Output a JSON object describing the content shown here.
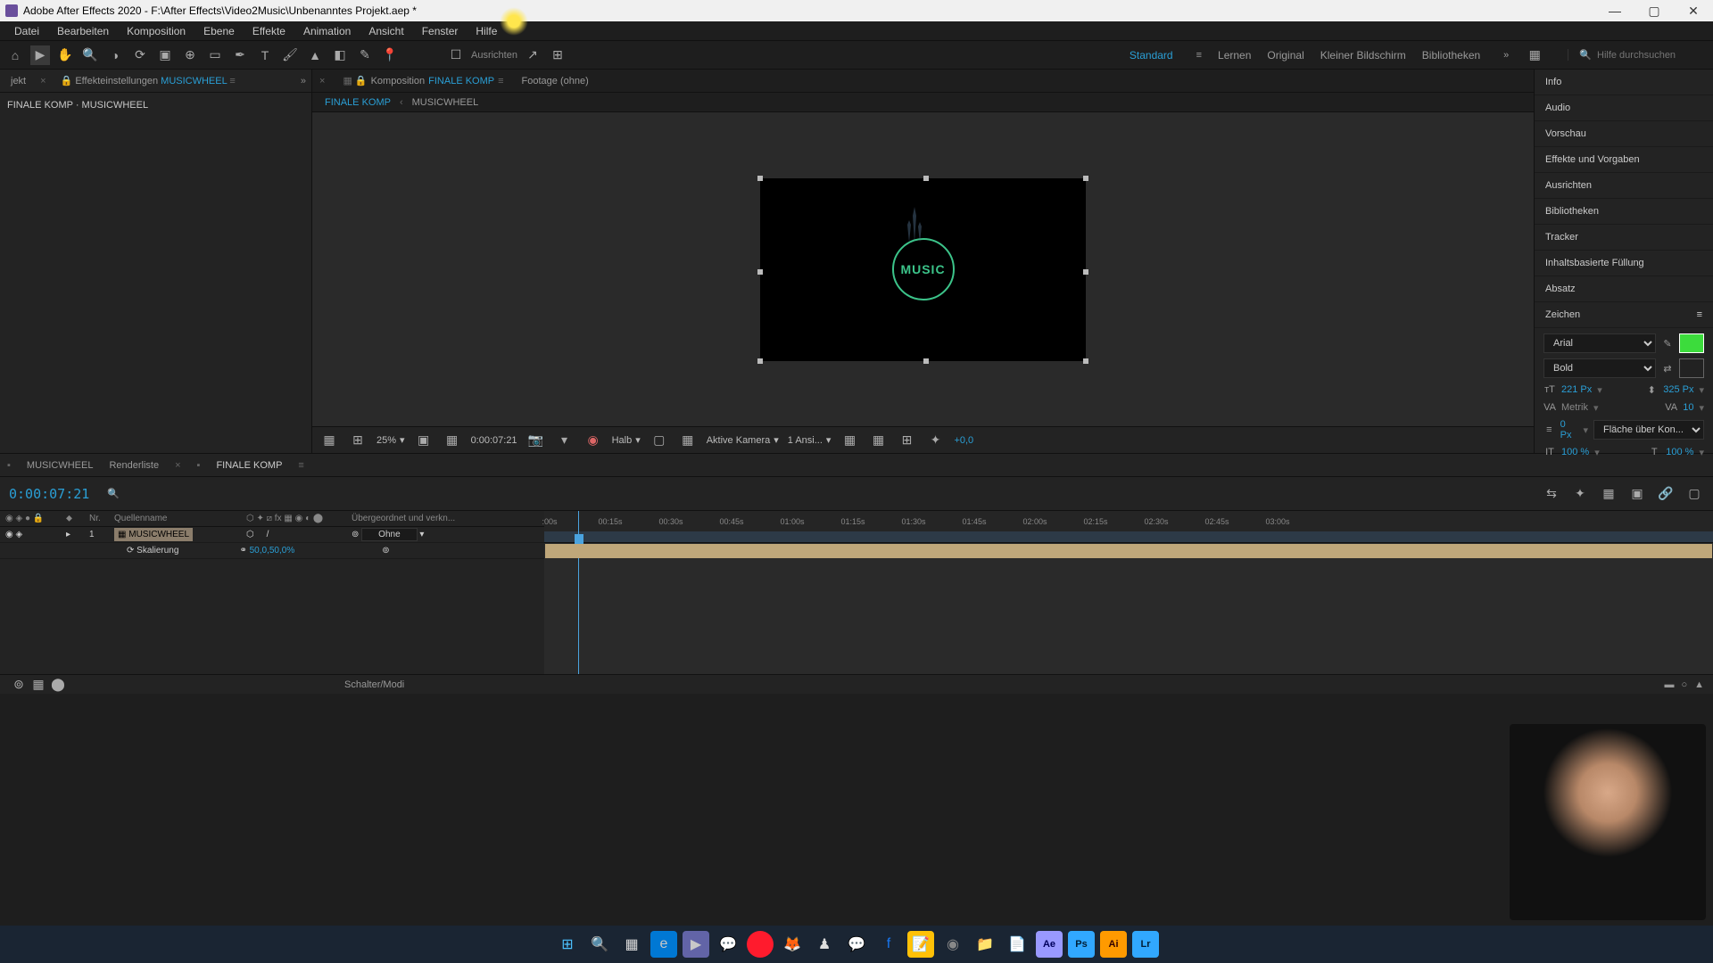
{
  "titlebar": {
    "app_name": "Adobe After Effects 2020",
    "project_path": "F:\\After Effects\\Video2Music\\Unbenanntes Projekt.aep *"
  },
  "menubar": [
    "Datei",
    "Bearbeiten",
    "Komposition",
    "Ebene",
    "Effekte",
    "Animation",
    "Ansicht",
    "Fenster",
    "Hilfe"
  ],
  "toolbar": {
    "snap_label": "Ausrichten",
    "workspaces": [
      "Standard",
      "Lernen",
      "Original",
      "Kleiner Bildschirm",
      "Bibliotheken"
    ],
    "active_workspace": "Standard",
    "search_placeholder": "Hilfe durchsuchen"
  },
  "left_panel": {
    "tab_project_short": "jekt",
    "tab_effect_controls": "Effekteinstellungen",
    "active_comp": "MUSICWHEEL",
    "breadcrumb": "FINALE KOMP · MUSICWHEEL"
  },
  "center_panel": {
    "tab_comp_prefix": "Komposition",
    "tab_comp_name": "FINALE KOMP",
    "tab_footage": "Footage (ohne)",
    "breadcrumb_1": "FINALE KOMP",
    "breadcrumb_2": "MUSICWHEEL",
    "preview_text": "MUSIC",
    "controls": {
      "zoom": "25%",
      "timecode": "0:00:07:21",
      "res": "Halb",
      "camera": "Aktive Kamera",
      "views": "1 Ansi...",
      "exposure": "+0,0"
    }
  },
  "right_panel": {
    "items": [
      "Info",
      "Audio",
      "Vorschau",
      "Effekte und Vorgaben",
      "Ausrichten",
      "Bibliotheken",
      "Tracker",
      "Inhaltsbasierte Füllung",
      "Absatz"
    ],
    "char_header": "Zeichen",
    "char": {
      "font": "Arial",
      "style": "Bold",
      "size": "221 Px",
      "leading": "325 Px",
      "kerning": "Metrik",
      "tracking": "10",
      "stroke_w": "0 Px",
      "stroke_mode": "Fläche über Kon...",
      "vscale": "100 %",
      "hscale": "100 %",
      "color": "#3cdc3c"
    }
  },
  "timeline": {
    "tabs": [
      "MUSICWHEEL",
      "Renderliste",
      "FINALE KOMP"
    ],
    "active_tab": "FINALE KOMP",
    "timecode": "0:00:07:21",
    "cols": {
      "nr": "Nr.",
      "source": "Quellenname",
      "parent": "Übergeordnet und verkn..."
    },
    "layer": {
      "num": "1",
      "name": "MUSICWHEEL",
      "prop_scale": "Skalierung",
      "scale_val": "50,0,50,0%",
      "parent": "Ohne"
    },
    "ruler_ticks": [
      ":00s",
      "00:15s",
      "00:30s",
      "00:45s",
      "01:00s",
      "01:15s",
      "01:30s",
      "01:45s",
      "02:00s",
      "02:15s",
      "02:30s",
      "02:45s",
      "03:00s"
    ],
    "footer": "Schalter/Modi"
  },
  "taskbar_icons": [
    "windows",
    "search",
    "taskview",
    "edge",
    "video",
    "whatsapp",
    "opera",
    "firefox",
    "steam",
    "messenger",
    "facebook",
    "notes",
    "obs",
    "explorer",
    "editor",
    "ae",
    "ps",
    "ai",
    "lr"
  ]
}
